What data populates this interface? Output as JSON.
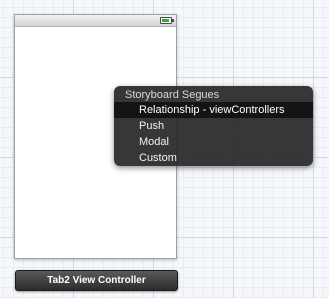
{
  "scene": {
    "title": "Tab2 View Controller",
    "status_icon": "battery-icon"
  },
  "menu": {
    "header": "Storyboard Segues",
    "items": [
      {
        "label": "Relationship - viewControllers",
        "selected": true
      },
      {
        "label": "Push",
        "selected": false
      },
      {
        "label": "Modal",
        "selected": false
      },
      {
        "label": "Custom",
        "selected": false
      }
    ]
  }
}
